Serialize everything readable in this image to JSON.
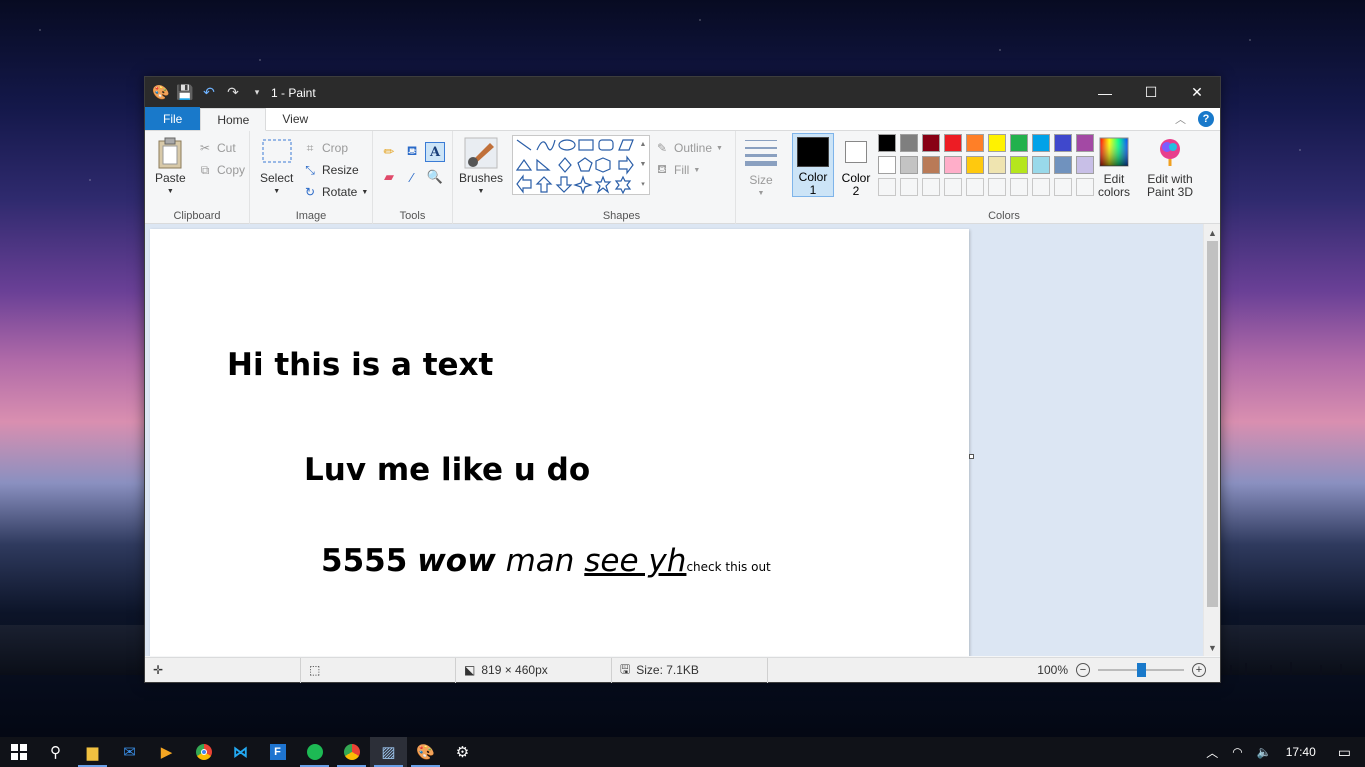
{
  "window": {
    "title": "1 - Paint"
  },
  "tabs": {
    "file": "File",
    "home": "Home",
    "view": "View"
  },
  "clipboard": {
    "paste": "Paste",
    "cut": "Cut",
    "copy": "Copy",
    "label": "Clipboard"
  },
  "image": {
    "select": "Select",
    "crop": "Crop",
    "resize": "Resize",
    "rotate": "Rotate",
    "label": "Image"
  },
  "tools": {
    "label": "Tools"
  },
  "brushes": {
    "label": "Brushes"
  },
  "shapes": {
    "outline": "Outline",
    "fill": "Fill",
    "label": "Shapes"
  },
  "size": {
    "label": "Size"
  },
  "colors": {
    "color1": "Color",
    "color1_num": "1",
    "color2": "Color",
    "color2_num": "2",
    "edit": "Edit",
    "edit2": "colors",
    "paint3d": "Edit with",
    "paint3d2": "Paint 3D",
    "label": "Colors",
    "color1_value": "#000000",
    "color2_value": "#ffffff",
    "row1": [
      "#000000",
      "#7f7f7f",
      "#880015",
      "#ed1c24",
      "#ff7f27",
      "#fff200",
      "#22b14c",
      "#00a2e8",
      "#3f48cc",
      "#a349a4"
    ],
    "row2": [
      "#ffffff",
      "#c3c3c3",
      "#b97a57",
      "#ffaec9",
      "#ffc90e",
      "#efe4b0",
      "#b5e61d",
      "#99d9ea",
      "#7092be",
      "#c8bfe7"
    ]
  },
  "canvas": {
    "line1": "Hi this is a text",
    "line2": "Luv me like u do",
    "line3a": "5555",
    "line3b": "wow",
    "line3c": "man",
    "line3d": "see yh",
    "line3e": "check this out"
  },
  "status": {
    "dimensions": "819 × 460px",
    "size": "Size: 7.1KB",
    "zoom": "100%"
  },
  "taskbar": {
    "time": "17:40"
  }
}
